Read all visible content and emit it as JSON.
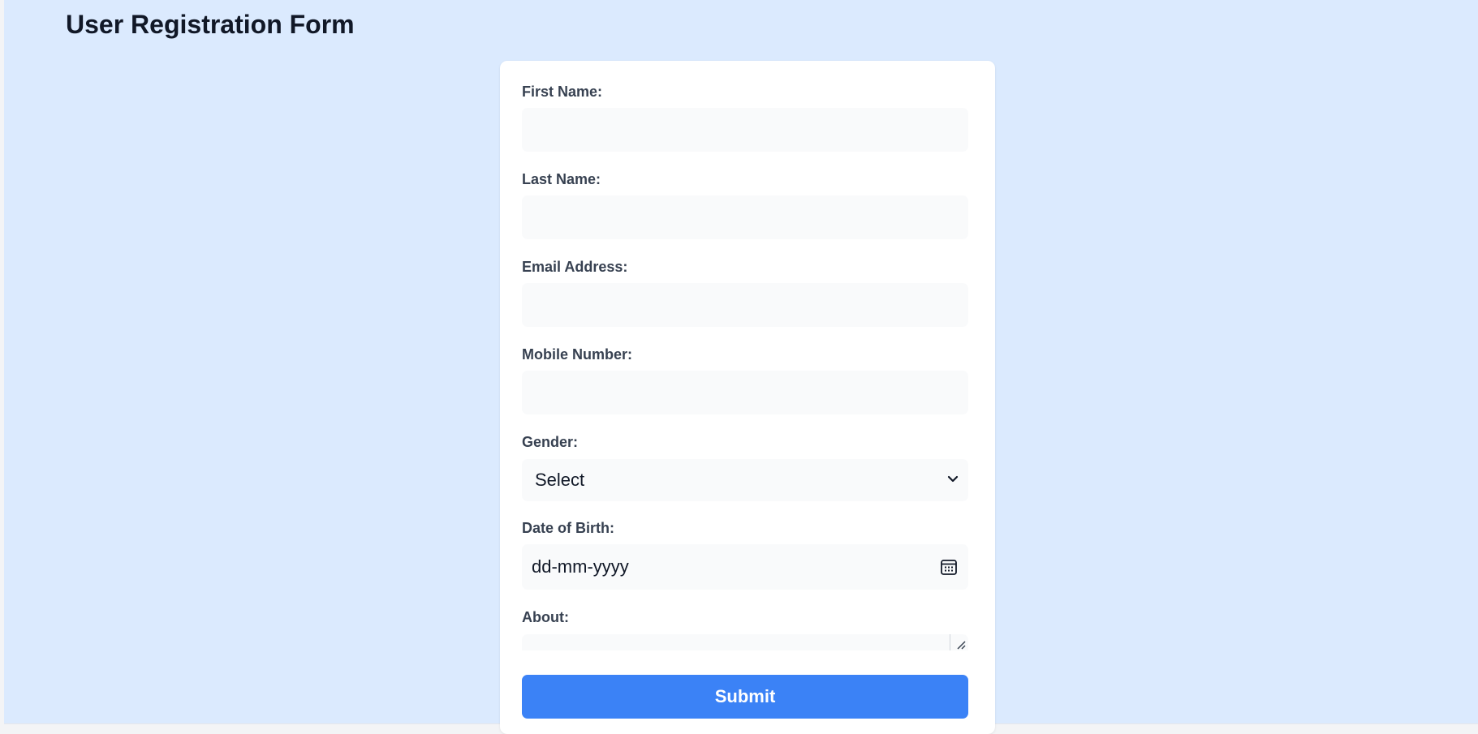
{
  "header": {
    "title": "User Registration Form"
  },
  "form": {
    "first_name": {
      "label": "First Name:",
      "value": ""
    },
    "last_name": {
      "label": "Last Name:",
      "value": ""
    },
    "email": {
      "label": "Email Address:",
      "value": ""
    },
    "mobile": {
      "label": "Mobile Number:",
      "value": ""
    },
    "gender": {
      "label": "Gender:",
      "selected": "Select"
    },
    "dob": {
      "label": "Date of Birth:",
      "placeholder": "dd-mm-yyyy"
    },
    "about": {
      "label": "About:",
      "value": ""
    },
    "submit_label": "Submit"
  },
  "colors": {
    "page_background": "#dbeafe",
    "card_background": "#ffffff",
    "input_background": "#f9fafb",
    "accent": "#3b82f6"
  },
  "icons": {
    "gender_dropdown": "chevron-down-icon",
    "dob_picker": "calendar-icon",
    "about_resize": "resize-grip-icon"
  }
}
